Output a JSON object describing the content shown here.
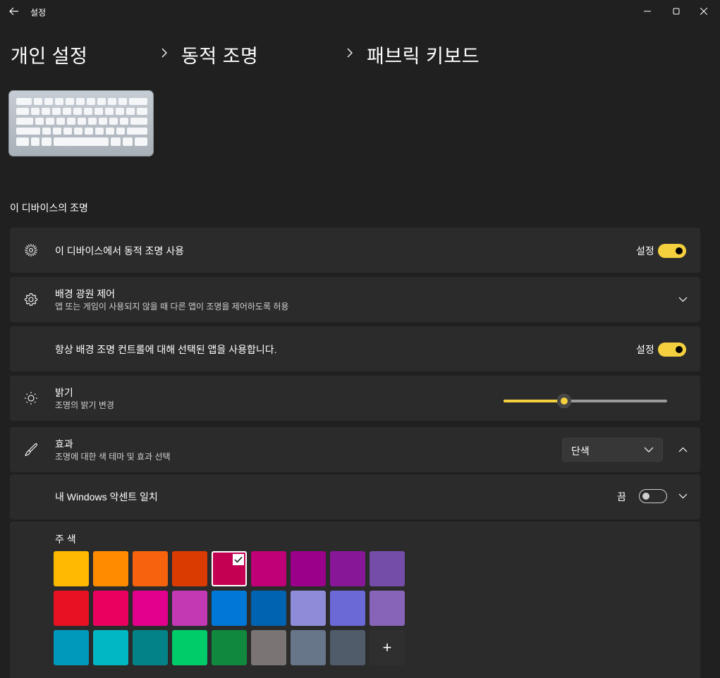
{
  "app": {
    "title": "설정"
  },
  "breadcrumb": [
    "개인 설정",
    "동적 조명",
    "패브릭 키보드"
  ],
  "section_title": "이 디바이스의 조명",
  "settings": {
    "dynamic_lighting": {
      "title": "이 디바이스에서 동적 조명 사용",
      "toggle_label": "설정",
      "on": true,
      "icon": "sparkle-burst-icon"
    },
    "background_control": {
      "title": "배경 광원 제어",
      "subtitle": "앱 또는 게임이 사용되지 않을 때 다른 앱이 조명을 제어하도록 허용",
      "icon": "gear-icon"
    },
    "always_use": {
      "title": "항상 배경 조명 컨트롤에 대해 선택된 앱을 사용합니다.",
      "toggle_label": "설정",
      "on": true
    },
    "brightness": {
      "title": "밝기",
      "subtitle": "조명의 밝기 변경",
      "value_fraction": 0.37,
      "icon": "sun-icon"
    },
    "effects": {
      "title": "효과",
      "subtitle": "조명에 대한 색 테마 및 효과 선택",
      "selected": "단색",
      "icon": "brush-icon"
    },
    "match_accent": {
      "title": "내 Windows 악센트 일치",
      "toggle_label": "끔",
      "on": false
    }
  },
  "palette": {
    "label": "주 색",
    "selected_index": 4,
    "rows": [
      [
        "#ffb900",
        "#ff8c00",
        "#f7630c",
        "#da3b01",
        "#c30052",
        "#bf0077",
        "#9a0089",
        "#881798",
        "#744da9"
      ],
      [
        "#e81123",
        "#ea005e",
        "#e3008c",
        "#c239b3",
        "#0078d7",
        "#0063b1",
        "#8e8cd8",
        "#6b69d6",
        "#8764b8"
      ],
      [
        "#0099bc",
        "#00b7c3",
        "#038387",
        "#00cc6a",
        "#10893e",
        "#7a7574",
        "#68768a",
        "#515c6b"
      ]
    ],
    "add_label": "+"
  },
  "colors": {
    "accent": "#f4d03f",
    "background": "#202020",
    "card": "#2b2b2b"
  }
}
